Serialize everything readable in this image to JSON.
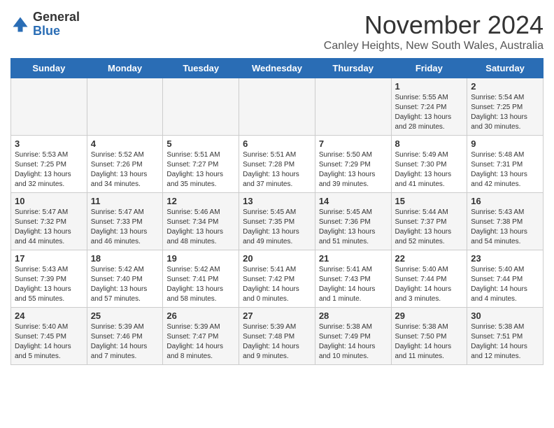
{
  "header": {
    "logo": {
      "general": "General",
      "blue": "Blue"
    },
    "title": "November 2024",
    "subtitle": "Canley Heights, New South Wales, Australia"
  },
  "weekdays": [
    "Sunday",
    "Monday",
    "Tuesday",
    "Wednesday",
    "Thursday",
    "Friday",
    "Saturday"
  ],
  "weeks": [
    [
      {
        "day": "",
        "info": ""
      },
      {
        "day": "",
        "info": ""
      },
      {
        "day": "",
        "info": ""
      },
      {
        "day": "",
        "info": ""
      },
      {
        "day": "",
        "info": ""
      },
      {
        "day": "1",
        "info": "Sunrise: 5:55 AM\nSunset: 7:24 PM\nDaylight: 13 hours and 28 minutes."
      },
      {
        "day": "2",
        "info": "Sunrise: 5:54 AM\nSunset: 7:25 PM\nDaylight: 13 hours and 30 minutes."
      }
    ],
    [
      {
        "day": "3",
        "info": "Sunrise: 5:53 AM\nSunset: 7:25 PM\nDaylight: 13 hours and 32 minutes."
      },
      {
        "day": "4",
        "info": "Sunrise: 5:52 AM\nSunset: 7:26 PM\nDaylight: 13 hours and 34 minutes."
      },
      {
        "day": "5",
        "info": "Sunrise: 5:51 AM\nSunset: 7:27 PM\nDaylight: 13 hours and 35 minutes."
      },
      {
        "day": "6",
        "info": "Sunrise: 5:51 AM\nSunset: 7:28 PM\nDaylight: 13 hours and 37 minutes."
      },
      {
        "day": "7",
        "info": "Sunrise: 5:50 AM\nSunset: 7:29 PM\nDaylight: 13 hours and 39 minutes."
      },
      {
        "day": "8",
        "info": "Sunrise: 5:49 AM\nSunset: 7:30 PM\nDaylight: 13 hours and 41 minutes."
      },
      {
        "day": "9",
        "info": "Sunrise: 5:48 AM\nSunset: 7:31 PM\nDaylight: 13 hours and 42 minutes."
      }
    ],
    [
      {
        "day": "10",
        "info": "Sunrise: 5:47 AM\nSunset: 7:32 PM\nDaylight: 13 hours and 44 minutes."
      },
      {
        "day": "11",
        "info": "Sunrise: 5:47 AM\nSunset: 7:33 PM\nDaylight: 13 hours and 46 minutes."
      },
      {
        "day": "12",
        "info": "Sunrise: 5:46 AM\nSunset: 7:34 PM\nDaylight: 13 hours and 48 minutes."
      },
      {
        "day": "13",
        "info": "Sunrise: 5:45 AM\nSunset: 7:35 PM\nDaylight: 13 hours and 49 minutes."
      },
      {
        "day": "14",
        "info": "Sunrise: 5:45 AM\nSunset: 7:36 PM\nDaylight: 13 hours and 51 minutes."
      },
      {
        "day": "15",
        "info": "Sunrise: 5:44 AM\nSunset: 7:37 PM\nDaylight: 13 hours and 52 minutes."
      },
      {
        "day": "16",
        "info": "Sunrise: 5:43 AM\nSunset: 7:38 PM\nDaylight: 13 hours and 54 minutes."
      }
    ],
    [
      {
        "day": "17",
        "info": "Sunrise: 5:43 AM\nSunset: 7:39 PM\nDaylight: 13 hours and 55 minutes."
      },
      {
        "day": "18",
        "info": "Sunrise: 5:42 AM\nSunset: 7:40 PM\nDaylight: 13 hours and 57 minutes."
      },
      {
        "day": "19",
        "info": "Sunrise: 5:42 AM\nSunset: 7:41 PM\nDaylight: 13 hours and 58 minutes."
      },
      {
        "day": "20",
        "info": "Sunrise: 5:41 AM\nSunset: 7:42 PM\nDaylight: 14 hours and 0 minutes."
      },
      {
        "day": "21",
        "info": "Sunrise: 5:41 AM\nSunset: 7:43 PM\nDaylight: 14 hours and 1 minute."
      },
      {
        "day": "22",
        "info": "Sunrise: 5:40 AM\nSunset: 7:44 PM\nDaylight: 14 hours and 3 minutes."
      },
      {
        "day": "23",
        "info": "Sunrise: 5:40 AM\nSunset: 7:44 PM\nDaylight: 14 hours and 4 minutes."
      }
    ],
    [
      {
        "day": "24",
        "info": "Sunrise: 5:40 AM\nSunset: 7:45 PM\nDaylight: 14 hours and 5 minutes."
      },
      {
        "day": "25",
        "info": "Sunrise: 5:39 AM\nSunset: 7:46 PM\nDaylight: 14 hours and 7 minutes."
      },
      {
        "day": "26",
        "info": "Sunrise: 5:39 AM\nSunset: 7:47 PM\nDaylight: 14 hours and 8 minutes."
      },
      {
        "day": "27",
        "info": "Sunrise: 5:39 AM\nSunset: 7:48 PM\nDaylight: 14 hours and 9 minutes."
      },
      {
        "day": "28",
        "info": "Sunrise: 5:38 AM\nSunset: 7:49 PM\nDaylight: 14 hours and 10 minutes."
      },
      {
        "day": "29",
        "info": "Sunrise: 5:38 AM\nSunset: 7:50 PM\nDaylight: 14 hours and 11 minutes."
      },
      {
        "day": "30",
        "info": "Sunrise: 5:38 AM\nSunset: 7:51 PM\nDaylight: 14 hours and 12 minutes."
      }
    ]
  ]
}
